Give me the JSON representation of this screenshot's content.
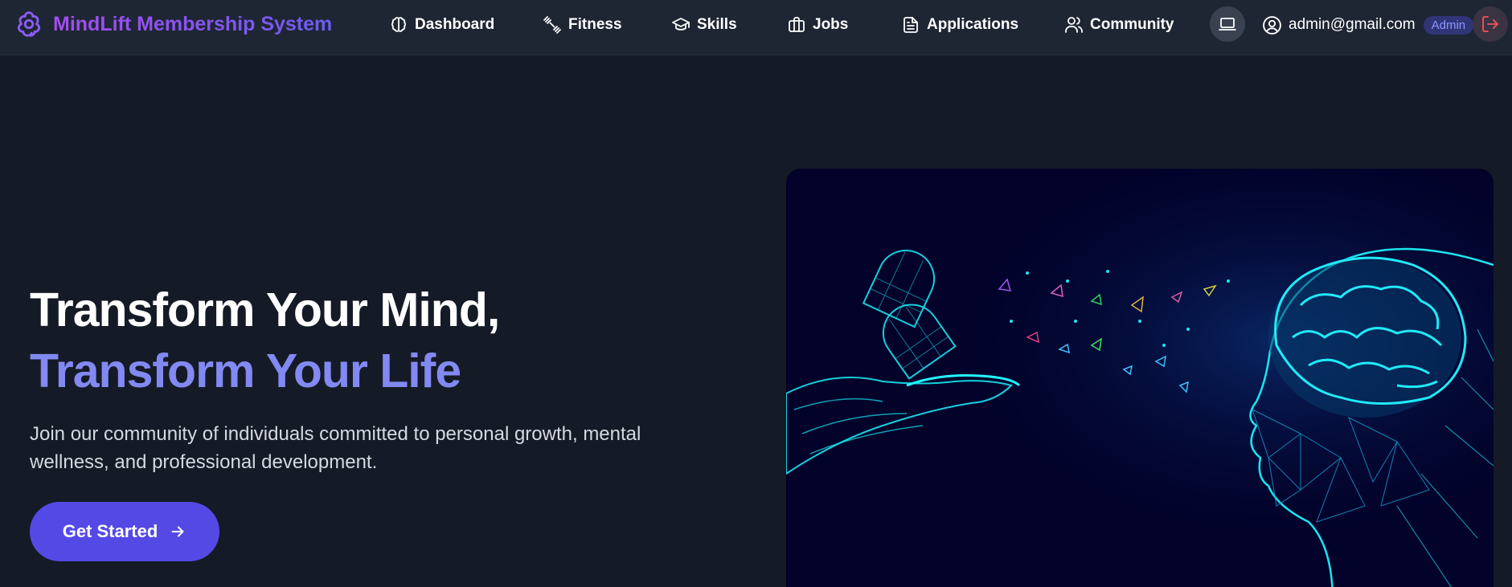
{
  "brand": {
    "name": "MindLift Membership System",
    "icon": "brain-icon"
  },
  "nav": {
    "items": [
      {
        "label": "Dashboard",
        "icon": "brain-icon"
      },
      {
        "label": "Fitness",
        "icon": "dumbbell-icon"
      },
      {
        "label": "Skills",
        "icon": "graduation-cap-icon"
      },
      {
        "label": "Jobs",
        "icon": "briefcase-icon"
      },
      {
        "label": "Applications",
        "icon": "document-icon"
      },
      {
        "label": "Community",
        "icon": "users-icon"
      }
    ]
  },
  "user": {
    "email": "admin@gmail.com",
    "role": "Admin"
  },
  "hero": {
    "title_line1": "Transform Your Mind,",
    "title_line2": "Transform Your Life",
    "subtitle": "Join our community of individuals committed to personal growth, mental wellness, and professional development.",
    "cta_label": "Get Started"
  },
  "colors": {
    "background": "#141b26",
    "navbar": "#1e2633",
    "accent": "#5549e6",
    "title_accent": "#8389f2",
    "logout": "#f0555a"
  }
}
